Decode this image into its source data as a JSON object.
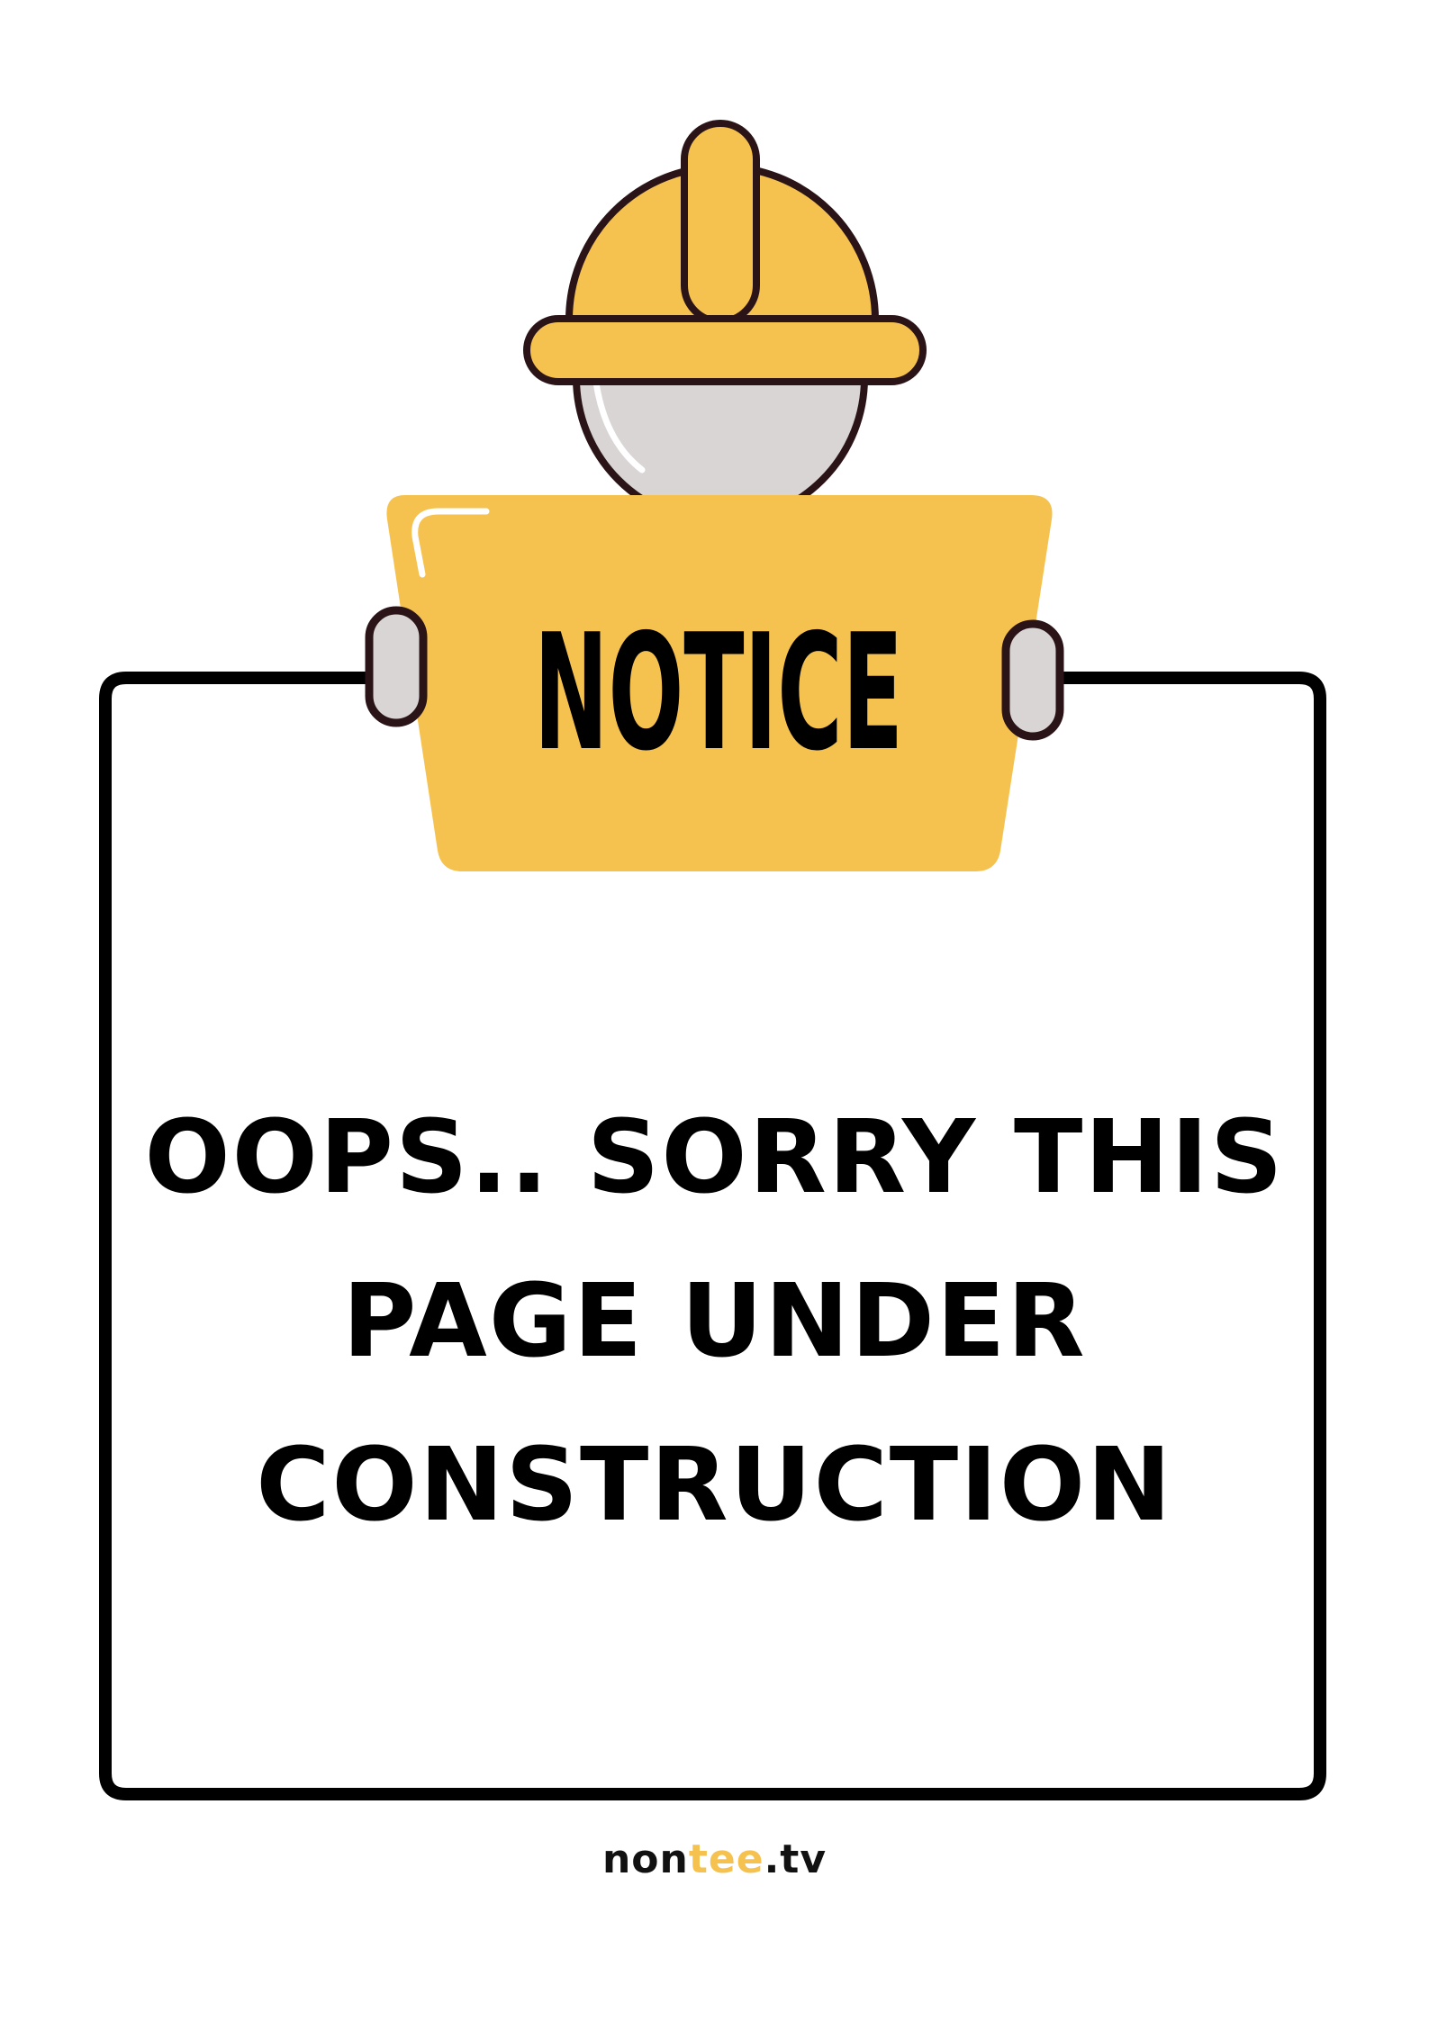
{
  "sign": {
    "label": "NOTICE"
  },
  "message": {
    "lines": [
      "OOPS.. SORRY THIS",
      "PAGE UNDER",
      "CONSTRUCTION"
    ]
  },
  "footer": {
    "brand_prefix": "non",
    "brand_accent": "tee",
    "brand_suffix": ".tv"
  },
  "colors": {
    "helmet": "#f6c24f",
    "sign": "#f6c24f",
    "face": "#d9d5d4",
    "outline": "#2b1418",
    "frame": "#000000",
    "brand_accent": "#f6c24f"
  }
}
